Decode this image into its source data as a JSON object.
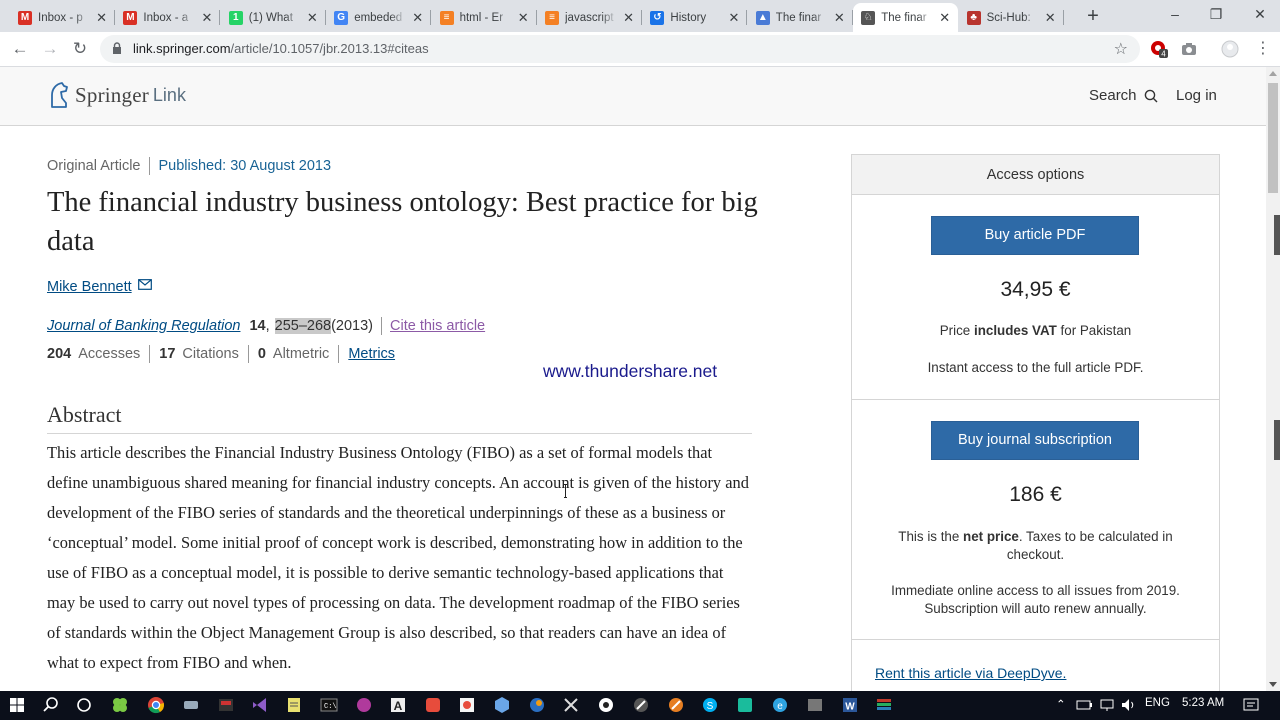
{
  "browser": {
    "tabs": [
      {
        "title": "Inbox - p",
        "icon": "gmail-icon",
        "color": "#d93025",
        "glyph": "M",
        "active": false
      },
      {
        "title": "Inbox - a",
        "icon": "gmail-icon",
        "color": "#d93025",
        "glyph": "M",
        "active": false
      },
      {
        "title": "(1) What",
        "icon": "whatsapp-icon",
        "color": "#25d366",
        "glyph": "1",
        "active": false
      },
      {
        "title": "embeded",
        "icon": "google-icon",
        "color": "#4285f4",
        "glyph": "G",
        "active": false
      },
      {
        "title": "html - Er",
        "icon": "stackoverflow-icon",
        "color": "#f48024",
        "glyph": "≡",
        "active": false
      },
      {
        "title": "javascript",
        "icon": "stackoverflow-icon",
        "color": "#f48024",
        "glyph": "≡",
        "active": false
      },
      {
        "title": "History",
        "icon": "history-icon",
        "color": "#1a73e8",
        "glyph": "↺",
        "active": false
      },
      {
        "title": "The finar",
        "icon": "mortarboard-icon",
        "color": "#4a7bd6",
        "glyph": "▲",
        "active": false
      },
      {
        "title": "The finar",
        "icon": "springer-icon",
        "color": "#555555",
        "glyph": "♘",
        "active": true
      },
      {
        "title": "Sci-Hub:",
        "icon": "scihub-icon",
        "color": "#b8342e",
        "glyph": "♣",
        "active": false
      }
    ],
    "url_host": "link.springer.com",
    "url_path": "/article/10.1057/jbr.2013.13#citeas",
    "extension_badge": "4"
  },
  "site": {
    "logo_word1": "Springer",
    "logo_word2": "Link",
    "search_label": "Search",
    "login_label": "Log in"
  },
  "article": {
    "type": "Original Article",
    "published": "Published: 30 August 2013",
    "title": "The financial industry business ontology: Best practice for big data",
    "author": "Mike Bennett",
    "journal": "Journal of Banking Regulation",
    "volume": "14",
    "volume_sep": ",",
    "pages": "255–268",
    "year": "(2013)",
    "cite_label": "Cite this article",
    "accesses_count": "204",
    "accesses_label": "Accesses",
    "citations_count": "17",
    "citations_label": "Citations",
    "altmetric_count": "0",
    "altmetric_label": "Altmetric",
    "metrics_label": "Metrics",
    "watermark": "www.thundershare.net",
    "abstract_heading": "Abstract",
    "abstract_text": "This article describes the Financial Industry Business Ontology (FIBO) as a set of formal models that define unambiguous shared meaning for financial industry concepts. An account is given of the history and development of the FIBO series of standards and the theoretical underpinnings of these as a business or ‘conceptual’ model. Some initial proof of concept work is described, demonstrating how in addition to the use of FIBO as a conceptual model, it is possible to derive semantic technology-based applications that may be used to carry out novel types of processing on data. The development roadmap of the FIBO series of standards within the Object Management Group is also described, so that readers can have an idea of what to expect from FIBO and when."
  },
  "access": {
    "heading": "Access options",
    "pdf_button": "Buy article PDF",
    "pdf_price": "34,95 €",
    "pdf_vat_pre": "Price ",
    "pdf_vat_bold": "includes VAT",
    "pdf_vat_post": " for Pakistan",
    "pdf_note": "Instant access to the full article PDF.",
    "sub_button": "Buy journal subscription",
    "sub_price": "186 €",
    "sub_net_pre": "This is the ",
    "sub_net_bold": "net price",
    "sub_net_post": ". Taxes to be calculated in checkout.",
    "sub_note": "Immediate online access to all issues from 2019. Subscription will auto renew annually.",
    "rent_link": "Rent this article via DeepDyve."
  },
  "taskbar": {
    "language": "ENG",
    "time": "5:23 AM"
  },
  "colors": {
    "springer_blue": "#2e6aa7",
    "link_blue": "#004b83",
    "visited_purple": "#8c5aa6",
    "taskbar_bg": "#0b0f1a"
  }
}
